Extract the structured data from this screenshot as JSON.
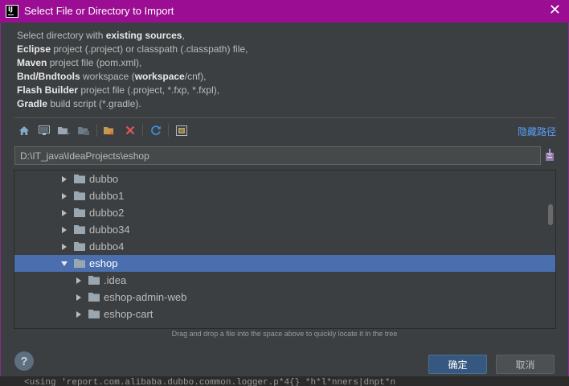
{
  "window": {
    "title": "Select File or Directory to Import",
    "close_label": "✕",
    "app_icon_text": "IJ"
  },
  "description": {
    "line1_pre": "Select directory with ",
    "line1_bold": "existing sources",
    "line1_post": ",",
    "line2_bold": "Eclipse",
    "line2_post": " project (.project) or classpath (.classpath) file,",
    "line3_bold": "Maven",
    "line3_post": " project file (pom.xml),",
    "line4_bold": "Bnd/Bndtools",
    "line4_mid": " workspace (",
    "line4_bold2": "workspace",
    "line4_post": "/cnf),",
    "line5_bold": "Flash Builder",
    "line5_post": " project file (.project, *.fxp, *.fxpl),",
    "line6_bold": "Gradle",
    "line6_post": " build script (*.gradle)."
  },
  "toolbar": {
    "icons": [
      "home-icon",
      "desktop-icon",
      "project-folder-icon",
      "module-folder-icon",
      "new-folder-icon",
      "delete-icon",
      "refresh-icon",
      "show-hidden-icon"
    ],
    "hide_path_label": "隐藏路径"
  },
  "path": {
    "value": "D:\\IT_java\\IdeaProjects\\eshop"
  },
  "tree": {
    "rows": [
      {
        "label": "dubbo",
        "level": 0,
        "expanded": false,
        "selected": false
      },
      {
        "label": "dubbo1",
        "level": 0,
        "expanded": false,
        "selected": false
      },
      {
        "label": "dubbo2",
        "level": 0,
        "expanded": false,
        "selected": false
      },
      {
        "label": "dubbo34",
        "level": 0,
        "expanded": false,
        "selected": false
      },
      {
        "label": "dubbo4",
        "level": 0,
        "expanded": false,
        "selected": false
      },
      {
        "label": "eshop",
        "level": 0,
        "expanded": true,
        "selected": true
      },
      {
        "label": ".idea",
        "level": 1,
        "expanded": false,
        "selected": false
      },
      {
        "label": "eshop-admin-web",
        "level": 1,
        "expanded": false,
        "selected": false
      },
      {
        "label": "eshop-cart",
        "level": 1,
        "expanded": false,
        "selected": false
      }
    ]
  },
  "hint": "Drag and drop a file into the space above to quickly locate it in the tree",
  "buttons": {
    "help": "?",
    "ok": "确定",
    "cancel": "取消"
  },
  "background_text": "<using 'report.com.alibaba.dubbo.common.logger.p*4{} *h*l*nners|dnpt*n"
}
